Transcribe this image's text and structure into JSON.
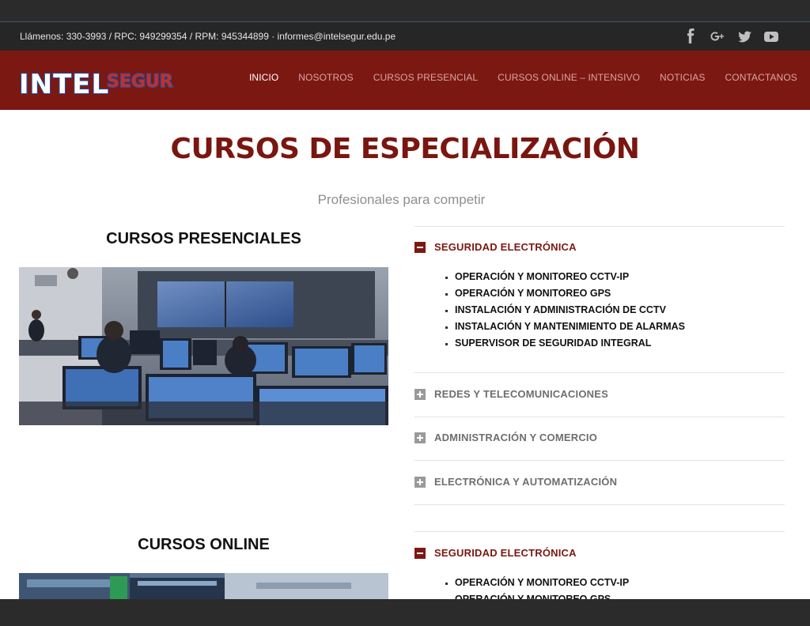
{
  "contact": {
    "text": "Llámenos: 330-3993 / RPC: 949299354 / RPM: 945344899 · informes@intelsegur.edu.pe",
    "social_icons": [
      "facebook-icon",
      "google-plus-icon",
      "twitter-icon",
      "youtube-icon"
    ]
  },
  "brand": {
    "logo_text_1": "INTEL",
    "logo_text_2": "SEGUR"
  },
  "nav": {
    "items": [
      "INICIO",
      "NOSOTROS",
      "CURSOS PRESENCIAL",
      "CURSOS ONLINE – INTENSIVO",
      "NOTICIAS",
      "CONTACTANOS"
    ],
    "active": "INICIO"
  },
  "page": {
    "title": "CURSOS DE ESPECIALIZACIÓN",
    "subtitle": "Profesionales para competir"
  },
  "presencial": {
    "title": "CURSOS PRESENCIALES",
    "accordion": [
      {
        "label": "SEGURIDAD ELECTRÓNICA",
        "expanded": true,
        "items": [
          "OPERACIÓN Y MONITOREO CCTV-IP",
          "OPERACIÓN Y MONITOREO GPS",
          "INSTALACIÓN Y ADMINISTRACIÓN DE CCTV",
          "INSTALACIÓN Y MANTENIMIENTO DE ALARMAS",
          "SUPERVISOR DE SEGURIDAD INTEGRAL"
        ]
      },
      {
        "label": "REDES Y TELECOMUNICACIONES",
        "expanded": false
      },
      {
        "label": "ADMINISTRACIÓN Y COMERCIO",
        "expanded": false
      },
      {
        "label": "ELECTRÓNICA Y AUTOMATIZACIÓN",
        "expanded": false
      }
    ]
  },
  "online": {
    "title": "CURSOS ONLINE",
    "accordion": [
      {
        "label": "SEGURIDAD ELECTRÓNICA",
        "expanded": true,
        "items": [
          "OPERACIÓN Y MONITOREO CCTV-IP",
          "OPERACIÓN Y MONITOREO GPS"
        ]
      }
    ]
  },
  "colors": {
    "brand_red": "#7c1812",
    "dark_bar": "#262626",
    "nav_inactive": "#d7a7a3"
  }
}
